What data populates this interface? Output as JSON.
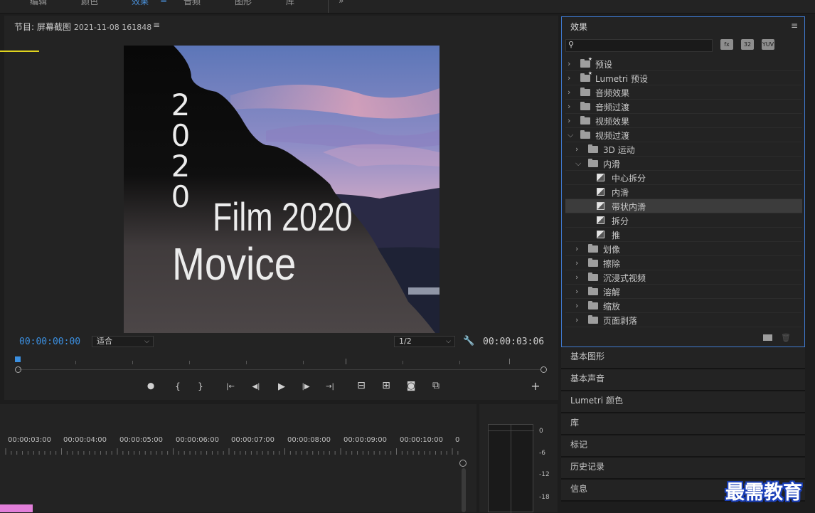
{
  "top_tabs": [
    {
      "label": "编辑",
      "active": false
    },
    {
      "label": "颜色",
      "active": false
    },
    {
      "label": "效果",
      "active": true
    },
    {
      "label": "音频",
      "active": false
    },
    {
      "label": "图形",
      "active": false
    },
    {
      "label": "库",
      "active": false
    }
  ],
  "top_menu_glyph": "≡",
  "top_overflow_glyph": "»",
  "program": {
    "title": "节目: 屏幕截图",
    "date": "2021-11-08 161848",
    "menu_glyph": "≡",
    "timecode_current": "00:00:00:00",
    "timecode_duration": "00:00:03:06",
    "fit_select": "适合",
    "resolution_select": "1/2",
    "video_text": {
      "vertical": [
        "2",
        "0",
        "2",
        "0"
      ],
      "film": "Film 2020",
      "movice": "Movice"
    },
    "controls": [
      {
        "name": "add-marker-button",
        "glyph": "⬤"
      },
      {
        "name": "mark-in-button",
        "glyph": "{"
      },
      {
        "name": "mark-out-button",
        "glyph": "}"
      },
      {
        "name": "go-to-in-button",
        "glyph": "|←"
      },
      {
        "name": "step-back-button",
        "glyph": "◀|"
      },
      {
        "name": "play-button",
        "glyph": "▶"
      },
      {
        "name": "step-forward-button",
        "glyph": "|▶"
      },
      {
        "name": "go-to-out-button",
        "glyph": "→|"
      },
      {
        "name": "lift-button",
        "glyph": "⊟"
      },
      {
        "name": "extract-button",
        "glyph": "⊞"
      },
      {
        "name": "export-frame-button",
        "glyph": "◙"
      },
      {
        "name": "comparison-view-button",
        "glyph": "⧉"
      },
      {
        "name": "button-editor-button",
        "glyph": "+"
      }
    ]
  },
  "effects": {
    "title": "效果",
    "menu_glyph": "≡",
    "search_placeholder": "",
    "buttons": [
      "accelerated-effects",
      "32",
      "YUV"
    ],
    "tree": [
      {
        "label": "预设",
        "level": 0,
        "expanded": false,
        "type": "folder-star"
      },
      {
        "label": "Lumetri 预设",
        "level": 0,
        "expanded": false,
        "type": "folder-star"
      },
      {
        "label": "音频效果",
        "level": 0,
        "expanded": false,
        "type": "folder"
      },
      {
        "label": "音频过渡",
        "level": 0,
        "expanded": false,
        "type": "folder"
      },
      {
        "label": "视频效果",
        "level": 0,
        "expanded": false,
        "type": "folder"
      },
      {
        "label": "视频过渡",
        "level": 0,
        "expanded": true,
        "type": "folder"
      },
      {
        "label": "3D 运动",
        "level": 1,
        "expanded": false,
        "type": "folder"
      },
      {
        "label": "内滑",
        "level": 1,
        "expanded": true,
        "type": "folder"
      },
      {
        "label": "中心拆分",
        "level": 2,
        "type": "effect"
      },
      {
        "label": "内滑",
        "level": 2,
        "type": "effect"
      },
      {
        "label": "带状内滑",
        "level": 2,
        "type": "effect",
        "selected": true
      },
      {
        "label": "拆分",
        "level": 2,
        "type": "effect"
      },
      {
        "label": "推",
        "level": 2,
        "type": "effect"
      },
      {
        "label": "划像",
        "level": 1,
        "expanded": false,
        "type": "folder"
      },
      {
        "label": "擦除",
        "level": 1,
        "expanded": false,
        "type": "folder"
      },
      {
        "label": "沉浸式视频",
        "level": 1,
        "expanded": false,
        "type": "folder"
      },
      {
        "label": "溶解",
        "level": 1,
        "expanded": false,
        "type": "folder"
      },
      {
        "label": "缩放",
        "level": 1,
        "expanded": false,
        "type": "folder"
      },
      {
        "label": "页面剥落",
        "level": 1,
        "expanded": false,
        "type": "folder"
      }
    ]
  },
  "side_panels": [
    "基本图形",
    "基本声音",
    "Lumetri 颜色",
    "库",
    "标记",
    "历史记录",
    "信息"
  ],
  "timeline": {
    "labels": [
      "00:00:03:00",
      "00:00:04:00",
      "00:00:05:00",
      "00:00:06:00",
      "00:00:07:00",
      "00:00:08:00",
      "00:00:09:00",
      "00:00:10:00",
      "0"
    ]
  },
  "meters": {
    "db_labels": [
      "0",
      "-6",
      "-12",
      "-18"
    ]
  },
  "watermark": "最需教育",
  "colors": {
    "accent_blue": "#3b8fe0",
    "panel_border": "#3f7ad1",
    "playhead_yellow": "#e0d41e",
    "clip_pink": "#e27fd9"
  }
}
